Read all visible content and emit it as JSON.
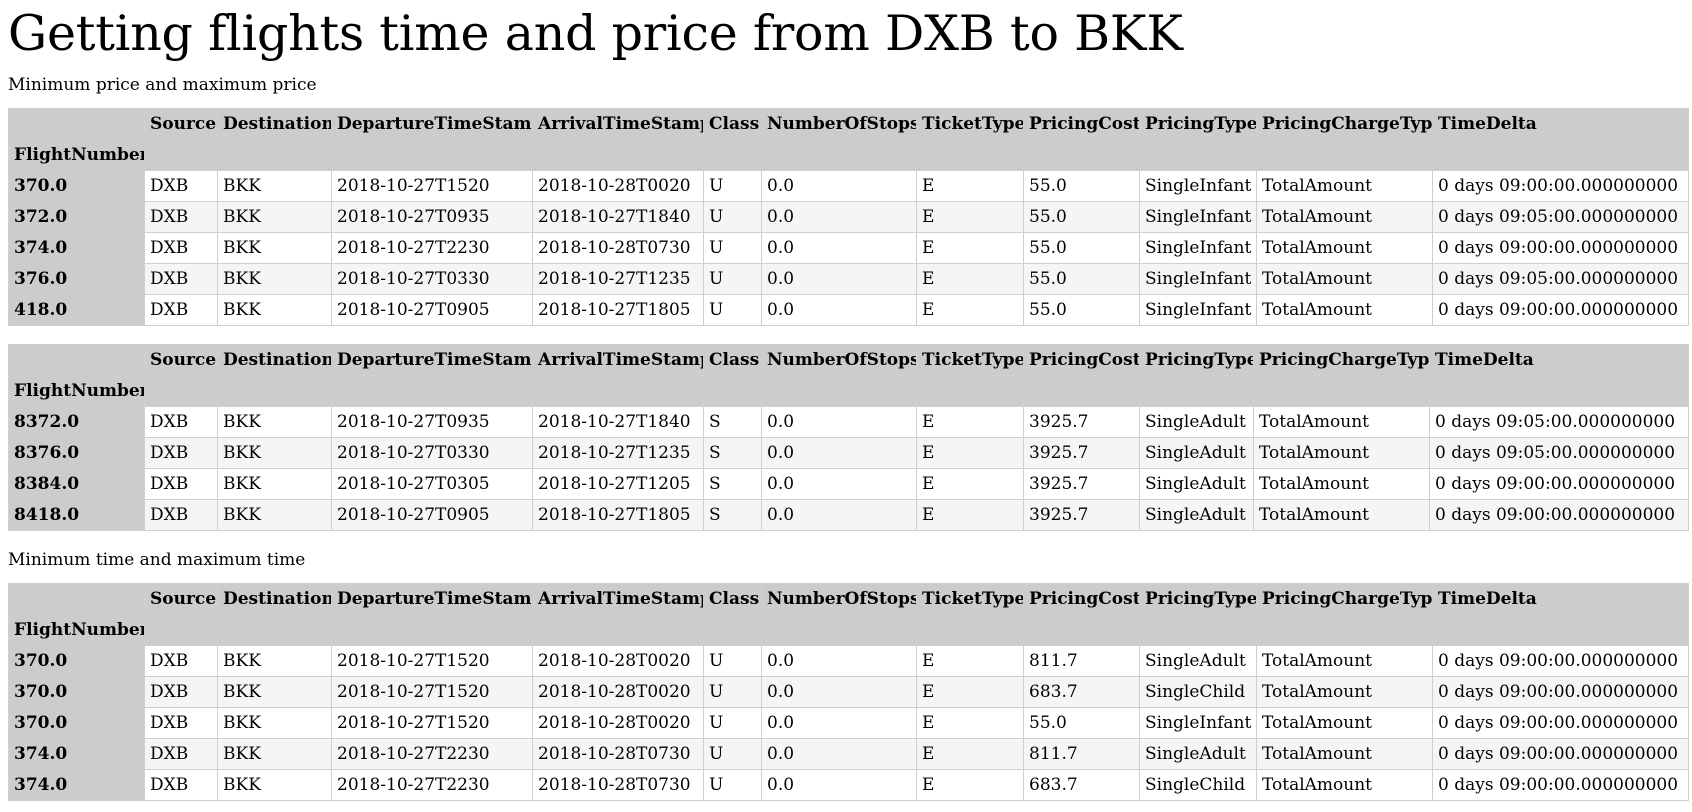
{
  "page": {
    "title": "Getting flights time and price from DXB to BKK",
    "section1_caption": "Minimum price and maximum price",
    "section2_caption": "Minimum time and maximum time"
  },
  "columns": [
    "Source",
    "Destination",
    "DepartureTimeStamp",
    "ArrivalTimeStamp",
    "Class",
    "NumberOfStops",
    "TicketType",
    "PricingCost",
    "PricingType",
    "PricingChargeType",
    "TimeDelta"
  ],
  "index_name": "FlightNumber",
  "tables": [
    {
      "rows": [
        {
          "flight": "370.0",
          "cells": [
            "DXB",
            "BKK",
            "2018-10-27T1520",
            "2018-10-28T0020",
            "U",
            "0.0",
            "E",
            "55.0",
            "SingleInfant",
            "TotalAmount",
            "0 days 09:00:00.000000000"
          ]
        },
        {
          "flight": "372.0",
          "cells": [
            "DXB",
            "BKK",
            "2018-10-27T0935",
            "2018-10-27T1840",
            "U",
            "0.0",
            "E",
            "55.0",
            "SingleInfant",
            "TotalAmount",
            "0 days 09:05:00.000000000"
          ]
        },
        {
          "flight": "374.0",
          "cells": [
            "DXB",
            "BKK",
            "2018-10-27T2230",
            "2018-10-28T0730",
            "U",
            "0.0",
            "E",
            "55.0",
            "SingleInfant",
            "TotalAmount",
            "0 days 09:00:00.000000000"
          ]
        },
        {
          "flight": "376.0",
          "cells": [
            "DXB",
            "BKK",
            "2018-10-27T0330",
            "2018-10-27T1235",
            "U",
            "0.0",
            "E",
            "55.0",
            "SingleInfant",
            "TotalAmount",
            "0 days 09:05:00.000000000"
          ]
        },
        {
          "flight": "418.0",
          "cells": [
            "DXB",
            "BKK",
            "2018-10-27T0905",
            "2018-10-27T1805",
            "U",
            "0.0",
            "E",
            "55.0",
            "SingleInfant",
            "TotalAmount",
            "0 days 09:00:00.000000000"
          ]
        }
      ]
    },
    {
      "rows": [
        {
          "flight": "8372.0",
          "cells": [
            "DXB",
            "BKK",
            "2018-10-27T0935",
            "2018-10-27T1840",
            "S",
            "0.0",
            "E",
            "3925.7",
            "SingleAdult",
            "TotalAmount",
            "0 days 09:05:00.000000000"
          ]
        },
        {
          "flight": "8376.0",
          "cells": [
            "DXB",
            "BKK",
            "2018-10-27T0330",
            "2018-10-27T1235",
            "S",
            "0.0",
            "E",
            "3925.7",
            "SingleAdult",
            "TotalAmount",
            "0 days 09:05:00.000000000"
          ]
        },
        {
          "flight": "8384.0",
          "cells": [
            "DXB",
            "BKK",
            "2018-10-27T0305",
            "2018-10-27T1205",
            "S",
            "0.0",
            "E",
            "3925.7",
            "SingleAdult",
            "TotalAmount",
            "0 days 09:00:00.000000000"
          ]
        },
        {
          "flight": "8418.0",
          "cells": [
            "DXB",
            "BKK",
            "2018-10-27T0905",
            "2018-10-27T1805",
            "S",
            "0.0",
            "E",
            "3925.7",
            "SingleAdult",
            "TotalAmount",
            "0 days 09:00:00.000000000"
          ]
        }
      ]
    },
    {
      "rows": [
        {
          "flight": "370.0",
          "cells": [
            "DXB",
            "BKK",
            "2018-10-27T1520",
            "2018-10-28T0020",
            "U",
            "0.0",
            "E",
            "811.7",
            "SingleAdult",
            "TotalAmount",
            "0 days 09:00:00.000000000"
          ]
        },
        {
          "flight": "370.0",
          "cells": [
            "DXB",
            "BKK",
            "2018-10-27T1520",
            "2018-10-28T0020",
            "U",
            "0.0",
            "E",
            "683.7",
            "SingleChild",
            "TotalAmount",
            "0 days 09:00:00.000000000"
          ]
        },
        {
          "flight": "370.0",
          "cells": [
            "DXB",
            "BKK",
            "2018-10-27T1520",
            "2018-10-28T0020",
            "U",
            "0.0",
            "E",
            "55.0",
            "SingleInfant",
            "TotalAmount",
            "0 days 09:00:00.000000000"
          ]
        },
        {
          "flight": "374.0",
          "cells": [
            "DXB",
            "BKK",
            "2018-10-27T2230",
            "2018-10-28T0730",
            "U",
            "0.0",
            "E",
            "811.7",
            "SingleAdult",
            "TotalAmount",
            "0 days 09:00:00.000000000"
          ]
        },
        {
          "flight": "374.0",
          "cells": [
            "DXB",
            "BKK",
            "2018-10-27T2230",
            "2018-10-28T0730",
            "U",
            "0.0",
            "E",
            "683.7",
            "SingleChild",
            "TotalAmount",
            "0 days 09:00:00.000000000"
          ]
        }
      ]
    }
  ]
}
